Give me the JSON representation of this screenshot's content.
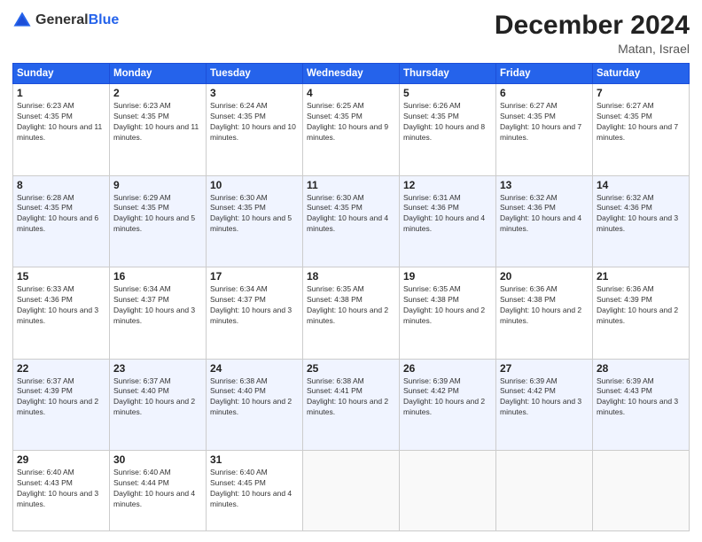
{
  "header": {
    "logo_general": "General",
    "logo_blue": "Blue",
    "month_title": "December 2024",
    "location": "Matan, Israel"
  },
  "weekdays": [
    "Sunday",
    "Monday",
    "Tuesday",
    "Wednesday",
    "Thursday",
    "Friday",
    "Saturday"
  ],
  "weeks": [
    [
      {
        "day": "1",
        "sunrise": "6:23 AM",
        "sunset": "4:35 PM",
        "daylight": "10 hours and 11 minutes."
      },
      {
        "day": "2",
        "sunrise": "6:23 AM",
        "sunset": "4:35 PM",
        "daylight": "10 hours and 11 minutes."
      },
      {
        "day": "3",
        "sunrise": "6:24 AM",
        "sunset": "4:35 PM",
        "daylight": "10 hours and 10 minutes."
      },
      {
        "day": "4",
        "sunrise": "6:25 AM",
        "sunset": "4:35 PM",
        "daylight": "10 hours and 9 minutes."
      },
      {
        "day": "5",
        "sunrise": "6:26 AM",
        "sunset": "4:35 PM",
        "daylight": "10 hours and 8 minutes."
      },
      {
        "day": "6",
        "sunrise": "6:27 AM",
        "sunset": "4:35 PM",
        "daylight": "10 hours and 7 minutes."
      },
      {
        "day": "7",
        "sunrise": "6:27 AM",
        "sunset": "4:35 PM",
        "daylight": "10 hours and 7 minutes."
      }
    ],
    [
      {
        "day": "8",
        "sunrise": "6:28 AM",
        "sunset": "4:35 PM",
        "daylight": "10 hours and 6 minutes."
      },
      {
        "day": "9",
        "sunrise": "6:29 AM",
        "sunset": "4:35 PM",
        "daylight": "10 hours and 5 minutes."
      },
      {
        "day": "10",
        "sunrise": "6:30 AM",
        "sunset": "4:35 PM",
        "daylight": "10 hours and 5 minutes."
      },
      {
        "day": "11",
        "sunrise": "6:30 AM",
        "sunset": "4:35 PM",
        "daylight": "10 hours and 4 minutes."
      },
      {
        "day": "12",
        "sunrise": "6:31 AM",
        "sunset": "4:36 PM",
        "daylight": "10 hours and 4 minutes."
      },
      {
        "day": "13",
        "sunrise": "6:32 AM",
        "sunset": "4:36 PM",
        "daylight": "10 hours and 4 minutes."
      },
      {
        "day": "14",
        "sunrise": "6:32 AM",
        "sunset": "4:36 PM",
        "daylight": "10 hours and 3 minutes."
      }
    ],
    [
      {
        "day": "15",
        "sunrise": "6:33 AM",
        "sunset": "4:36 PM",
        "daylight": "10 hours and 3 minutes."
      },
      {
        "day": "16",
        "sunrise": "6:34 AM",
        "sunset": "4:37 PM",
        "daylight": "10 hours and 3 minutes."
      },
      {
        "day": "17",
        "sunrise": "6:34 AM",
        "sunset": "4:37 PM",
        "daylight": "10 hours and 3 minutes."
      },
      {
        "day": "18",
        "sunrise": "6:35 AM",
        "sunset": "4:38 PM",
        "daylight": "10 hours and 2 minutes."
      },
      {
        "day": "19",
        "sunrise": "6:35 AM",
        "sunset": "4:38 PM",
        "daylight": "10 hours and 2 minutes."
      },
      {
        "day": "20",
        "sunrise": "6:36 AM",
        "sunset": "4:38 PM",
        "daylight": "10 hours and 2 minutes."
      },
      {
        "day": "21",
        "sunrise": "6:36 AM",
        "sunset": "4:39 PM",
        "daylight": "10 hours and 2 minutes."
      }
    ],
    [
      {
        "day": "22",
        "sunrise": "6:37 AM",
        "sunset": "4:39 PM",
        "daylight": "10 hours and 2 minutes."
      },
      {
        "day": "23",
        "sunrise": "6:37 AM",
        "sunset": "4:40 PM",
        "daylight": "10 hours and 2 minutes."
      },
      {
        "day": "24",
        "sunrise": "6:38 AM",
        "sunset": "4:40 PM",
        "daylight": "10 hours and 2 minutes."
      },
      {
        "day": "25",
        "sunrise": "6:38 AM",
        "sunset": "4:41 PM",
        "daylight": "10 hours and 2 minutes."
      },
      {
        "day": "26",
        "sunrise": "6:39 AM",
        "sunset": "4:42 PM",
        "daylight": "10 hours and 2 minutes."
      },
      {
        "day": "27",
        "sunrise": "6:39 AM",
        "sunset": "4:42 PM",
        "daylight": "10 hours and 3 minutes."
      },
      {
        "day": "28",
        "sunrise": "6:39 AM",
        "sunset": "4:43 PM",
        "daylight": "10 hours and 3 minutes."
      }
    ],
    [
      {
        "day": "29",
        "sunrise": "6:40 AM",
        "sunset": "4:43 PM",
        "daylight": "10 hours and 3 minutes."
      },
      {
        "day": "30",
        "sunrise": "6:40 AM",
        "sunset": "4:44 PM",
        "daylight": "10 hours and 4 minutes."
      },
      {
        "day": "31",
        "sunrise": "6:40 AM",
        "sunset": "4:45 PM",
        "daylight": "10 hours and 4 minutes."
      },
      null,
      null,
      null,
      null
    ]
  ]
}
